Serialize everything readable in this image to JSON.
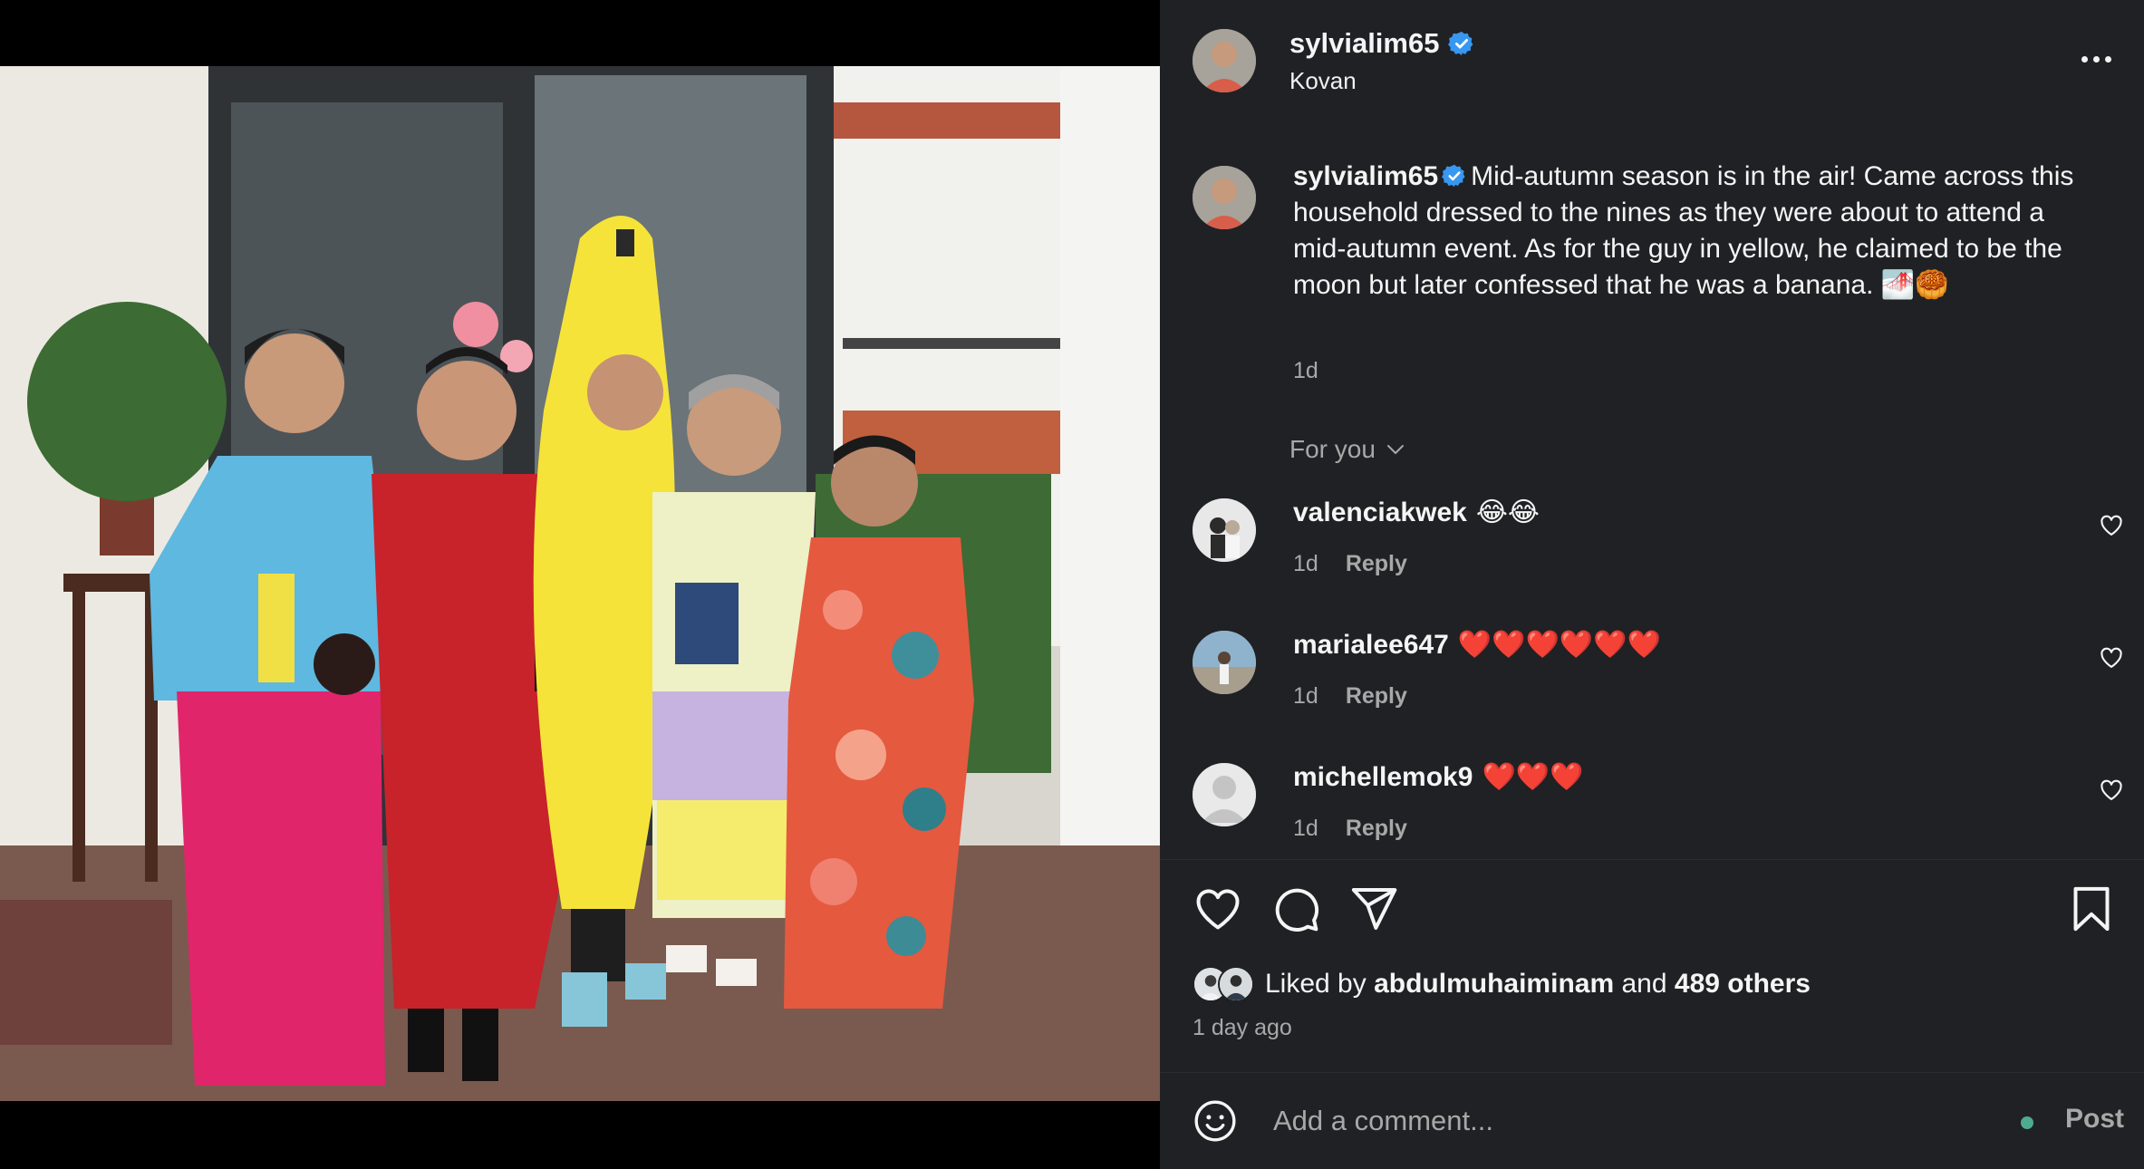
{
  "post": {
    "username": "sylvialim65",
    "verified": true,
    "location": "Kovan",
    "caption_text": "Mid-autumn season is in the air! Came across this household dressed to the nines as they were about to attend a mid-autumn event. As for the guy in yellow, he claimed to be the moon but later confessed that he was a banana. 🌁🥮",
    "caption_time": "1d",
    "image_icon": "photo-of-five-people-in-costumes"
  },
  "comments_section": {
    "filter_label": "For you",
    "reply_label": "Reply",
    "items": [
      {
        "username": "valenciakwek",
        "text": "😂😂",
        "time": "1d"
      },
      {
        "username": "marialee647",
        "text": "❤️❤️❤️❤️❤️❤️",
        "time": "1d"
      },
      {
        "username": "michellemok9",
        "text": "❤️❤️❤️",
        "time": "1d"
      }
    ]
  },
  "likes": {
    "prefix": "Liked by",
    "liker": "abdulmuhaiminam",
    "joiner": "and",
    "others": "489 others",
    "posted_ago": "1 day ago"
  },
  "comment_box": {
    "placeholder": "Add a comment...",
    "post_label": "Post"
  },
  "icons": {
    "verified": "verified-badge-icon",
    "more": "more-options-icon",
    "like": "heart-icon",
    "comment": "comment-bubble-icon",
    "share": "paper-plane-icon",
    "save": "bookmark-icon",
    "emoji": "smiley-icon"
  },
  "colors": {
    "panel_bg": "#202124",
    "verified_blue": "#3897f0",
    "muted_text": "#a8a8a8",
    "status_dot": "#58c3a3"
  }
}
